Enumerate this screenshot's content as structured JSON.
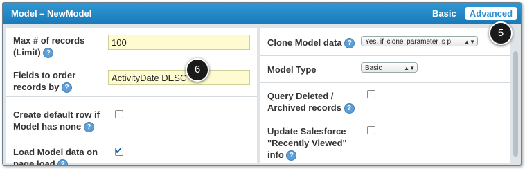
{
  "header": {
    "title": "Model – NewModel",
    "tab_basic": "Basic",
    "tab_advanced": "Advanced"
  },
  "left": {
    "max_records": {
      "label_line1": "Max # of records",
      "label_line2": "(Limit)",
      "value": "100"
    },
    "order_fields": {
      "label_line1": "Fields to order",
      "label_line2": "records by",
      "value": "ActivityDate DESC"
    },
    "default_row": {
      "label_line1": "Create default row if",
      "label_line2": "Model has none",
      "checked": false
    },
    "load_data": {
      "label_line1": "Load Model data on",
      "label_line2": "page load",
      "checked": true
    }
  },
  "right": {
    "clone": {
      "label": "Clone Model data",
      "selected": "Yes, if 'clone' parameter is p"
    },
    "model_type": {
      "label": "Model Type",
      "selected": "Basic"
    },
    "query_deleted": {
      "label_line1": "Query Deleted /",
      "label_line2": "Archived records",
      "checked": false
    },
    "recently_viewed": {
      "label_line1": "Update Salesforce",
      "label_line2": "\"Recently Viewed\"",
      "label_line3": "info",
      "checked": false
    }
  },
  "callouts": {
    "five": "5",
    "six": "6"
  },
  "colors": {
    "header": "#1f86c6",
    "input_bg": "#fefbd0",
    "help_icon": "#5d9fd6"
  }
}
